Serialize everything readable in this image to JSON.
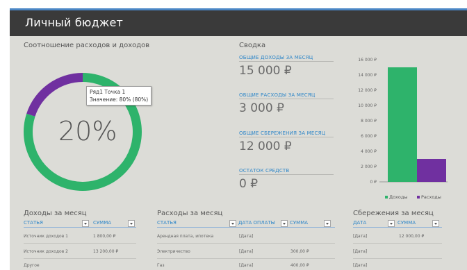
{
  "app": {
    "title": "Личный бюджет"
  },
  "ratio": {
    "title": "Соотношение расходов и доходов",
    "center_label": "20%",
    "tooltip": {
      "series": "Ряд1 Точка 1",
      "value": "Значение: 80% (80%)"
    }
  },
  "summary": {
    "title": "Сводка",
    "items": [
      {
        "label": "ОБЩИЕ ДОХОДЫ ЗА МЕСЯЦ",
        "value": "15 000 ₽"
      },
      {
        "label": "ОБЩИЕ РАСХОДЫ ЗА МЕСЯЦ",
        "value": "3 000 ₽"
      },
      {
        "label": "ОБЩИЕ СБЕРЕЖЕНИЯ ЗА МЕСЯЦ",
        "value": "12 000 ₽"
      },
      {
        "label": "ОСТАТОК СРЕДСТВ",
        "value": "0 ₽"
      }
    ]
  },
  "income": {
    "title": "Доходы за месяц",
    "headers": [
      "СТАТЬЯ",
      "СУММА"
    ],
    "rows": [
      [
        "Источник доходов 1",
        "1 800,00 ₽"
      ],
      [
        "Источник доходов 2",
        "13 200,00 ₽"
      ],
      [
        "Другое",
        ""
      ]
    ]
  },
  "expenses": {
    "title": "Расходы за месяц",
    "headers": [
      "СТАТЬЯ",
      "ДАТА ОПЛАТЫ",
      "СУММА"
    ],
    "rows": [
      [
        "Арендная плата, ипотека",
        "[Дата]",
        ""
      ],
      [
        "Электричество",
        "[Дата]",
        "300,00 ₽"
      ],
      [
        "Газ",
        "[Дата]",
        "400,00 ₽"
      ]
    ]
  },
  "savings": {
    "title": "Сбережения за месяц",
    "headers": [
      "ДАТА",
      "СУММА"
    ],
    "rows": [
      [
        "[Дата]",
        "12 000,00 ₽"
      ],
      [
        "[Дата]",
        ""
      ],
      [
        "[Дата]",
        ""
      ]
    ]
  },
  "colors": {
    "green": "#2eb36b",
    "purple": "#7030a0",
    "accent": "#2e86c8",
    "header": "#3a3a3a",
    "background": "#dcdcd7"
  },
  "chart_data": [
    {
      "type": "pie",
      "categories": [
        "",
        ""
      ],
      "values": [
        80,
        20
      ],
      "colors": [
        "#2eb36b",
        "#7030a0"
      ]
    },
    {
      "type": "bar",
      "categories": [
        "Доходы",
        "Расходы"
      ],
      "values": [
        15000,
        3000
      ],
      "colors": [
        "#2eb36b",
        "#7030a0"
      ],
      "ylim": [
        0,
        16000
      ],
      "yticks": [
        "0 ₽",
        "2 000 ₽",
        "4 000 ₽",
        "6 000 ₽",
        "8 000 ₽",
        "10 000 ₽",
        "12 000 ₽",
        "14 000 ₽",
        "16 000 ₽"
      ],
      "legend": "bottom"
    }
  ]
}
